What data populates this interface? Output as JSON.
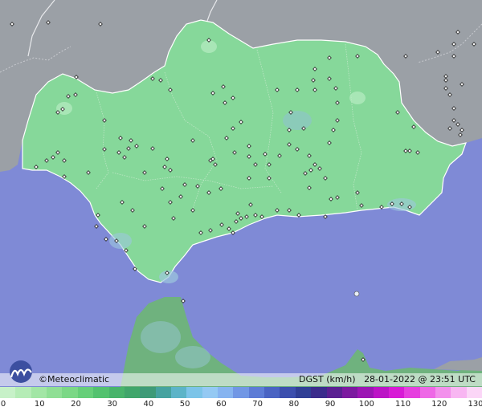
{
  "brand": {
    "label": "©Meteoclimatic"
  },
  "info": {
    "variable": "DGST (km/h)",
    "datetime": "28-01-2022 @ 23:51 UTC"
  },
  "scale": {
    "colors": [
      "#c7f1c8",
      "#b5ecb6",
      "#a2e6a5",
      "#8fdf95",
      "#7bd886",
      "#66cf79",
      "#53c26f",
      "#48b46b",
      "#40a66b",
      "#3e9b78",
      "#46a3a0",
      "#5cb4c8",
      "#7cc4e8",
      "#94c9f3",
      "#86b4f0",
      "#7197e5",
      "#5d7cd6",
      "#4a64c3",
      "#3c4fae",
      "#303f96",
      "#3b2c8c",
      "#5b2092",
      "#7c1aa0",
      "#9c16b4",
      "#bc14c6",
      "#d81bd6",
      "#e63fdf",
      "#ee68e6",
      "#f390ec",
      "#f8b6f2",
      "#fbd6f7"
    ],
    "ticks": [
      "0",
      "10",
      "20",
      "30",
      "40",
      "50",
      "60",
      "70",
      "80",
      "90",
      "100",
      "110",
      "120",
      "130"
    ]
  },
  "colors": {
    "sea": "#7f8ad6",
    "land_main": "#86d89a",
    "land_outer": "#9ba0a6",
    "africa": "#6fb27e"
  }
}
